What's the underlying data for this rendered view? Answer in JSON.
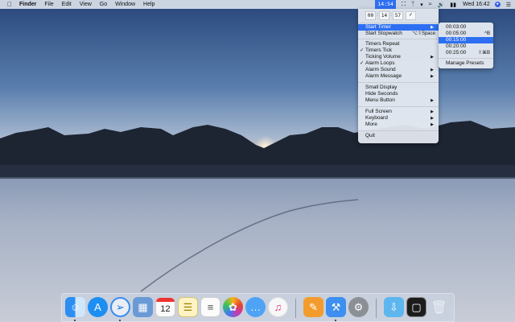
{
  "menubar": {
    "apple_icon": "apple-logo-icon",
    "app_name": "Finder",
    "items": [
      "File",
      "Edit",
      "View",
      "Go",
      "Window",
      "Help"
    ],
    "timer_display": "14:54",
    "clock": "Wed 16:42"
  },
  "timer_menu": {
    "hours": "00",
    "minutes": "14",
    "seconds": "57",
    "confirm_icon": "checkmark-icon",
    "items": {
      "start_timer": "Start Timer",
      "start_stopwatch": "Start Stopwatch",
      "start_stopwatch_shortcut": "⌥⇧Space",
      "timers_repeat": "Timers Repeat",
      "timers_tick": "Timers Tick",
      "ticking_volume": "Ticking Volume",
      "alarm_loops": "Alarm Loops",
      "alarm_sound": "Alarm Sound",
      "alarm_message": "Alarm Message",
      "small_display": "Small Display",
      "hide_seconds": "Hide Seconds",
      "menu_button": "Menu Button",
      "full_screen": "Full Screen",
      "keyboard": "Keyboard",
      "more": "More",
      "quit": "Quit"
    }
  },
  "preset_submenu": {
    "presets": [
      {
        "label": "00:03:00",
        "shortcut": ""
      },
      {
        "label": "00:05:00",
        "shortcut": "^B"
      },
      {
        "label": "00:15:00",
        "shortcut": ""
      },
      {
        "label": "00:20:00",
        "shortcut": ""
      },
      {
        "label": "00:25:00",
        "shortcut": "⇧⌘B"
      }
    ],
    "selected_index": 2,
    "manage": "Manage Presets"
  },
  "dock": {
    "calendar_day": "12",
    "apps": [
      "finder",
      "app-store",
      "safari",
      "preview",
      "calendar",
      "notes",
      "reminders",
      "photos",
      "messages",
      "itunes",
      "pages",
      "xcode",
      "system-preferences",
      "downloads",
      "screenshot",
      "trash"
    ]
  },
  "colors": {
    "highlight": "#2e6ff2",
    "menu_bg": "#e4e9f0"
  }
}
